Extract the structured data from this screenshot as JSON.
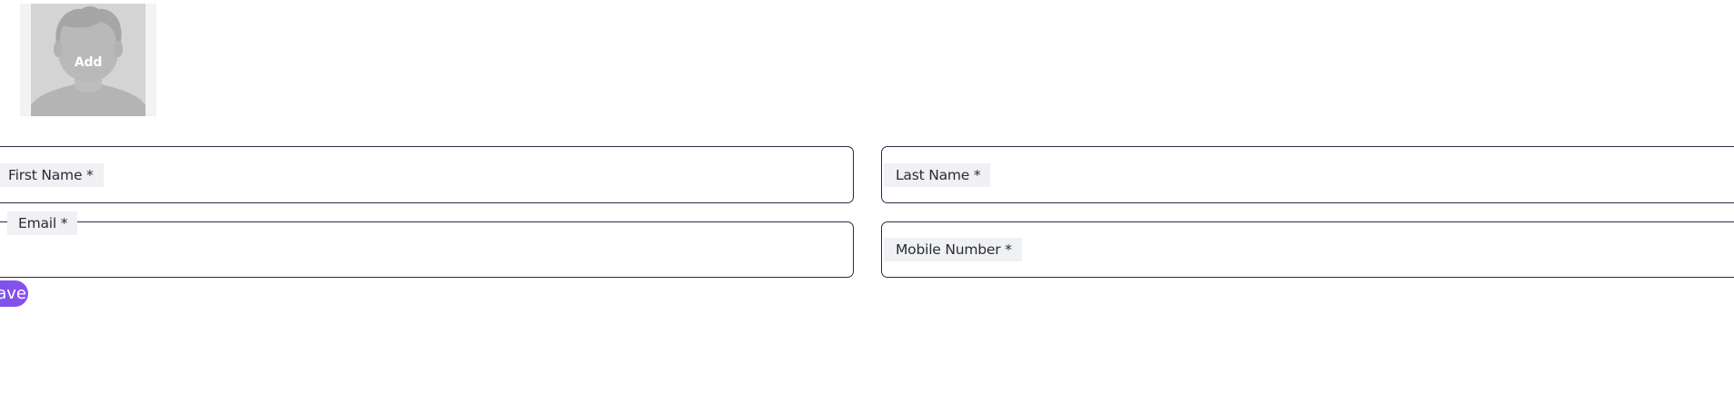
{
  "avatar": {
    "add_label": "Add",
    "icon": "person-silhouette-icon"
  },
  "form": {
    "first_name": {
      "label": "First Name *",
      "value": ""
    },
    "last_name": {
      "label": "Last Name *",
      "value": ""
    },
    "email": {
      "label": "Email *",
      "value": ""
    },
    "mobile_number": {
      "label": "Mobile Number *",
      "value": ""
    }
  },
  "actions": {
    "save_label": "Save"
  },
  "colors": {
    "field_border": "#2c2a4a",
    "label_background": "#f0f1f4",
    "button_gradient_start": "#6a5be0",
    "button_gradient_end": "#8a4ff0",
    "avatar_background": "#d4d4d4"
  }
}
